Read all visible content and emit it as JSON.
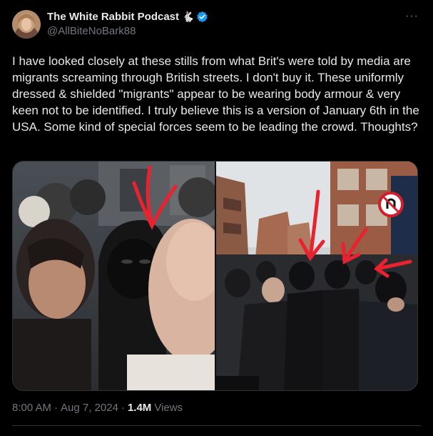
{
  "author": {
    "display_name": "The White Rabbit Podcast",
    "emoji": "🐇",
    "verified_icon": "verified-badge-icon",
    "handle": "@AllBiteNoBark88",
    "avatar_icon": "avatar-photo"
  },
  "more_label": "···",
  "tweet_text": "I have looked closely at these stills from what Brit's were told by media are migrants screaming through British streets. I don't buy it. These uniformly dressed & shielded \"migrants\" appear to be wearing body armour & very keen not to be identified. I truly believe this is a version of January 6th in the USA. Some kind of special forces seem to be leading the crowd. Thoughts?",
  "media": {
    "images": [
      {
        "icon": "crowd-closeup-photo"
      },
      {
        "icon": "street-crowd-photo"
      }
    ]
  },
  "meta": {
    "time": "8:00 AM",
    "separator": "·",
    "date": "Aug 7, 2024",
    "separator2": "·",
    "views_count": "1.4M",
    "views_label": "Views"
  },
  "colors": {
    "background": "#000000",
    "text": "#e7e9ea",
    "muted": "#71767b",
    "verified": "#1d9bf0",
    "arrow_red": "#e8222e"
  }
}
